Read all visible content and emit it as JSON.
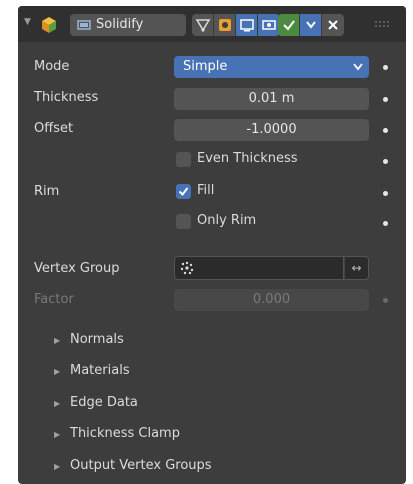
{
  "modifier": {
    "name": "Solidify",
    "colors": {
      "accent": "#4772b3",
      "apply_green": "#4b8a3f",
      "panel_bg": "#3d3d3d",
      "header_bg": "#303030"
    }
  },
  "header": {
    "icons": [
      "collapse-arrow-icon",
      "modifier-type-icon",
      "edit-mode-cage-icon",
      "edit-mode-icon",
      "viewport-display-icon",
      "render-display-icon",
      "apply-check-icon",
      "dropdown-chevron-icon",
      "remove-x-icon",
      "drag-grip-icon"
    ]
  },
  "fields": {
    "mode_label": "Mode",
    "mode_value": "Simple",
    "thickness_label": "Thickness",
    "thickness_value": "0.01 m",
    "offset_label": "Offset",
    "offset_value": "-1.0000",
    "even_thickness_label": "Even Thickness",
    "even_thickness_checked": false,
    "rim_label": "Rim",
    "fill_label": "Fill",
    "fill_checked": true,
    "only_rim_label": "Only Rim",
    "only_rim_checked": false,
    "vertex_group_label": "Vertex Group",
    "vertex_group_value": "",
    "invert_glyph": "↔",
    "factor_label": "Factor",
    "factor_value": "0.000"
  },
  "subpanels": [
    {
      "label": "Normals"
    },
    {
      "label": "Materials"
    },
    {
      "label": "Edge Data"
    },
    {
      "label": "Thickness Clamp"
    },
    {
      "label": "Output Vertex Groups"
    }
  ]
}
